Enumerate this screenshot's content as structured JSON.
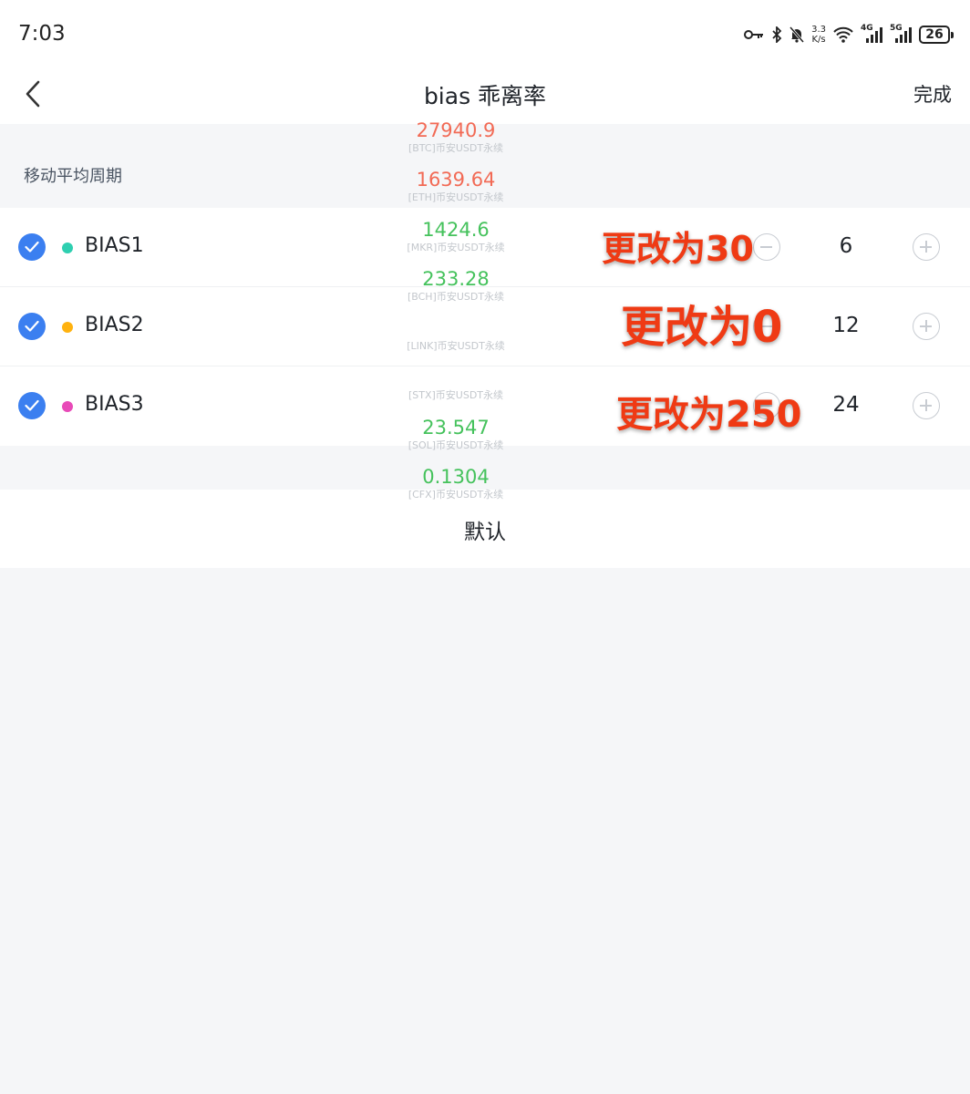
{
  "status_bar": {
    "time": "7:03",
    "speed": "3.3",
    "speed_unit": "K/s",
    "net1": "4G",
    "net2": "5G",
    "battery": "26"
  },
  "nav": {
    "title": "bias 乖离率",
    "done": "完成"
  },
  "section": {
    "label": "移动平均周期"
  },
  "rows": [
    {
      "label": "BIAS1",
      "value": "6",
      "dot_color": "#2ecfb0"
    },
    {
      "label": "BIAS2",
      "value": "12",
      "dot_color": "#ffb20f"
    },
    {
      "label": "BIAS3",
      "value": "24",
      "dot_color": "#e84ab8"
    }
  ],
  "default_label": "默认",
  "ticker": [
    {
      "price": "27940.9",
      "name": "[BTC]币安USDT永续",
      "trend": "up"
    },
    {
      "price": "1639.64",
      "name": "[ETH]币安USDT永续",
      "trend": "up"
    },
    {
      "price": "1424.6",
      "name": "[MKR]币安USDT永续",
      "trend": "down"
    },
    {
      "price": "233.28",
      "name": "[BCH]币安USDT永续",
      "trend": "down"
    },
    {
      "price": "",
      "name": "[LINK]币安USDT永续",
      "trend": "down"
    },
    {
      "price": "",
      "name": "[STX]币安USDT永续",
      "trend": "down"
    },
    {
      "price": "23.547",
      "name": "[SOL]币安USDT永续",
      "trend": "down"
    },
    {
      "price": "0.1304",
      "name": "[CFX]币安USDT永续",
      "trend": "down"
    }
  ],
  "annotations": [
    "更改为30",
    "更改为0",
    "更改为250"
  ],
  "colors": {
    "accent": "#3b7ff0",
    "up": "#f26a55",
    "down": "#45c25c",
    "annotation": "#ef3a14"
  }
}
